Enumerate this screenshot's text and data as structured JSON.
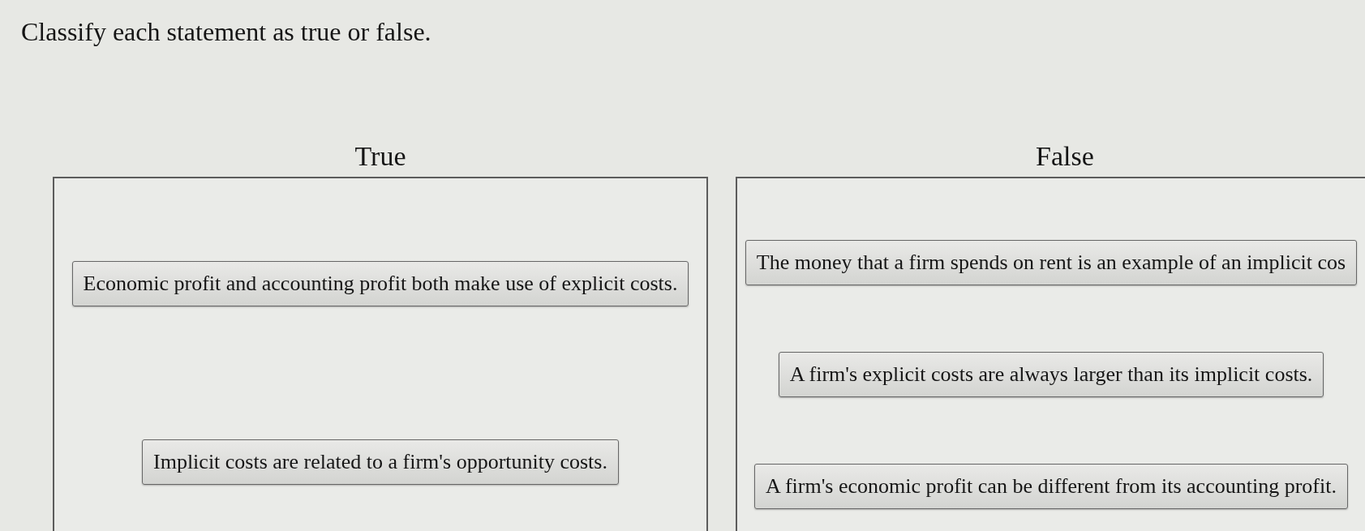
{
  "instruction": "Classify each statement as true or false.",
  "bins": [
    {
      "label": "True",
      "items": [
        "Economic profit and accounting profit both make use of explicit costs.",
        "Implicit costs are related to a firm's opportunity costs."
      ]
    },
    {
      "label": "False",
      "items": [
        "The money that a firm spends on rent is an example of an implicit cos",
        "A firm's explicit costs are always larger than its implicit costs.",
        "A firm's economic profit can be different from its accounting profit."
      ]
    }
  ]
}
